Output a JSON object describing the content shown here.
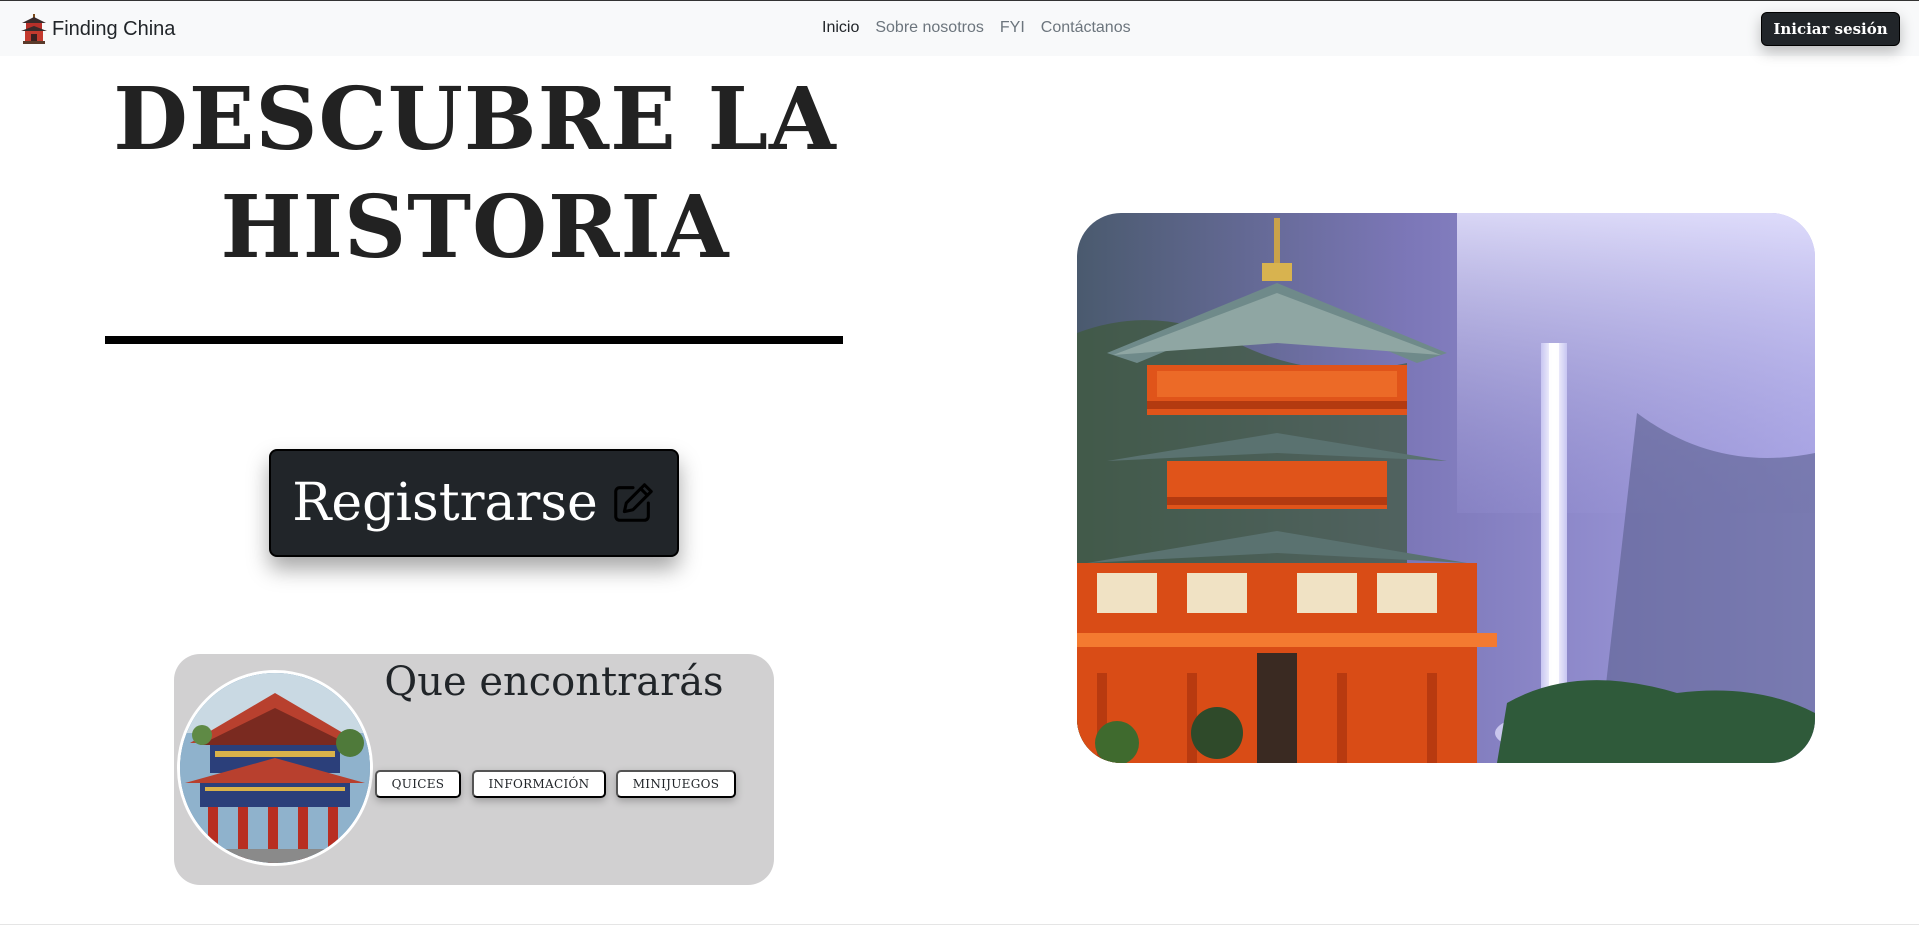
{
  "navbar": {
    "brand": "Finding China",
    "links": [
      {
        "label": "Inicio",
        "active": true
      },
      {
        "label": "Sobre nosotros",
        "active": false
      },
      {
        "label": "FYI",
        "active": false
      },
      {
        "label": "Contáctanos",
        "active": false
      }
    ],
    "login_label": "Iniciar sesión"
  },
  "hero": {
    "title_line1": "DESCUBRE LA",
    "title_line2": "HISTORIA",
    "register_label": "Registrarse",
    "register_icon": "edit-icon"
  },
  "features": {
    "title": "Que encontrarás",
    "chips": [
      "QUICES",
      "INFORMACIÓN",
      "MINIJUEGOS"
    ]
  },
  "colors": {
    "dark": "#212529",
    "card_bg": "#d1d0d1",
    "navbar_bg": "#f8f9fa",
    "pagoda_orange": "#e8541c"
  }
}
